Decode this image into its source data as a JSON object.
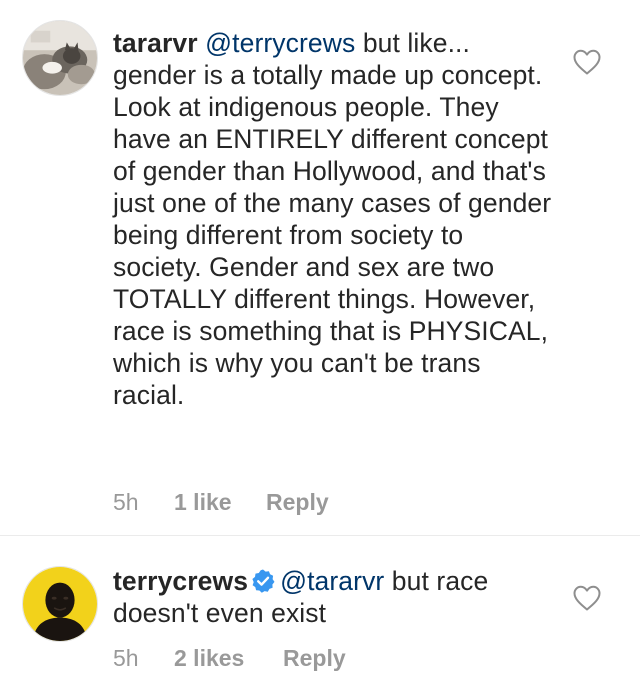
{
  "comments": [
    {
      "username": "tararvr",
      "mention": "@terrycrews",
      "text": " but like... gender is a totally made up concept. Look at indigenous people. They have an ENTIRELY different concept of gender than Hollywood, and that's just one of the many cases of gender being different from society to society. Gender and sex are two TOTALLY different things. However, race is something that is PHYSICAL, which is why you can't be trans racial.",
      "time": "5h",
      "likes": "1 like",
      "reply_label": "Reply",
      "avatar_icon": "cat-photo-avatar",
      "like_icon": "heart-outline-icon",
      "verified": false
    },
    {
      "username": "terrycrews",
      "mention": "@tararvr",
      "text": " but race doesn't even exist",
      "time": "5h",
      "likes": "2 likes",
      "reply_label": "Reply",
      "avatar_icon": "person-yellow-avatar",
      "like_icon": "heart-outline-icon",
      "verified": true,
      "verified_icon": "verified-badge-icon"
    }
  ],
  "colors": {
    "text": "#262626",
    "mention": "#003569",
    "meta": "#999999",
    "verified": "#3897f0",
    "avatar_yellow": "#f2d21b",
    "divider": "#ebebeb"
  }
}
